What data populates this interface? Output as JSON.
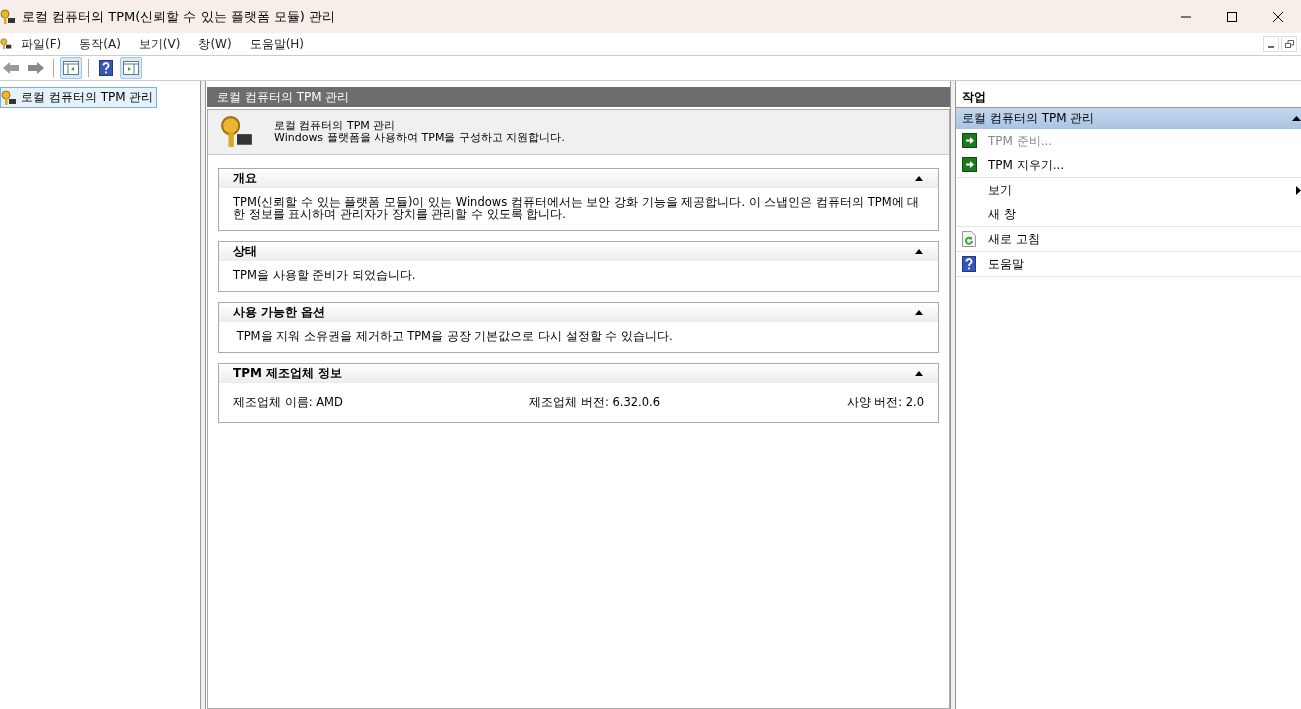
{
  "window": {
    "title": "로컬 컴퓨터의 TPM(신뢰할 수 있는 플랫폼 모듈) 관리"
  },
  "menu": [
    "파일(F)",
    "동작(A)",
    "보기(V)",
    "창(W)",
    "도움말(H)"
  ],
  "tree": {
    "items": [
      {
        "label": "로컬 컴퓨터의 TPM 관리",
        "selected": true
      }
    ]
  },
  "center": {
    "header": "로컬 컴퓨터의 TPM 관리",
    "intro": {
      "title": "로컬 컴퓨터의 TPM 관리",
      "subtitle": "Windows 플랫폼을 사용하여 TPM을 구성하고 지원합니다."
    },
    "sections": [
      {
        "title": "개요",
        "expanded": true,
        "kind": "text",
        "text": "TPM(신뢰할 수 있는 플랫폼 모듈)이 있는 Windows 컴퓨터에서는 보안 강화 기능을 제공합니다. 이 스냅인은 컴퓨터의 TPM에 대한 정보를 표시하며 관리자가 장치를 관리할 수 있도록 합니다."
      },
      {
        "title": "상태",
        "expanded": true,
        "kind": "text",
        "text": "TPM을 사용할 준비가 되었습니다."
      },
      {
        "title": "사용 가능한 옵션",
        "expanded": true,
        "kind": "text",
        "text": " TPM을 지워 소유권을 제거하고 TPM을 공장 기본값으로 다시 설정할 수 있습니다."
      },
      {
        "title": "TPM 제조업체 정보",
        "expanded": true,
        "kind": "fields",
        "fields": [
          "제조업체 이름: AMD",
          "제조업체 버전: 6.32.0.6",
          "사양 버전: 2.0"
        ]
      }
    ]
  },
  "actions": {
    "header": "작업",
    "group_title": "로컬 컴퓨터의 TPM 관리",
    "expanded": true,
    "groups": [
      [
        {
          "label": "TPM 준비...",
          "kind": "arrow",
          "disabled": true,
          "submenu": false
        },
        {
          "label": "TPM 지우기...",
          "kind": "arrow",
          "disabled": false,
          "submenu": false
        }
      ],
      [
        {
          "label": "보기",
          "kind": "plain",
          "disabled": false,
          "submenu": true
        },
        {
          "label": "새 창",
          "kind": "plain",
          "disabled": false,
          "submenu": false
        }
      ],
      [
        {
          "label": "새로 고침",
          "kind": "refresh",
          "disabled": false,
          "submenu": false
        }
      ],
      [
        {
          "label": "도움말",
          "kind": "help",
          "disabled": false,
          "submenu": false
        }
      ]
    ]
  }
}
